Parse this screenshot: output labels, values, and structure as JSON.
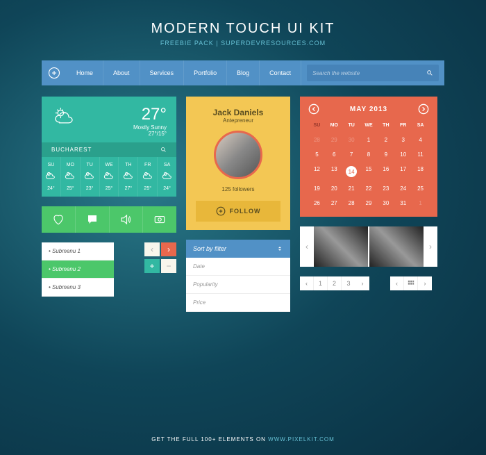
{
  "header": {
    "title": "MODERN TOUCH UI KIT",
    "subtitle_prefix": "FREEBIE PACK  |  ",
    "subtitle_link": "SUPERDEVRESOURCES.COM"
  },
  "nav": {
    "items": [
      "Home",
      "About",
      "Services",
      "Portfolio",
      "Blog",
      "Contact"
    ],
    "search_placeholder": "Search the website"
  },
  "weather": {
    "temp": "27°",
    "condition": "Mostly Sunny",
    "range": "27°/15°",
    "city": "BUCHAREST",
    "forecast": [
      {
        "d": "SU",
        "t": "24°"
      },
      {
        "d": "MO",
        "t": "25°"
      },
      {
        "d": "TU",
        "t": "23°"
      },
      {
        "d": "WE",
        "t": "25°"
      },
      {
        "d": "TH",
        "t": "27°"
      },
      {
        "d": "FR",
        "t": "25°"
      },
      {
        "d": "SA",
        "t": "24°"
      }
    ]
  },
  "submenu": [
    "Submenu 1",
    "Submenu 2",
    "Submenu 3"
  ],
  "profile": {
    "name": "Jack Daniels",
    "role": "Antepreneur",
    "followers": "125 followers",
    "follow": "FOLLOW"
  },
  "sort": {
    "header": "Sort by filter",
    "items": [
      "Date",
      "Popularity",
      "Price"
    ]
  },
  "calendar": {
    "month": "MAY 2013",
    "dow": [
      "SU",
      "MO",
      "TU",
      "WE",
      "TH",
      "FR",
      "SA"
    ],
    "days": [
      {
        "n": "28",
        "m": true
      },
      {
        "n": "29",
        "m": true
      },
      {
        "n": "30",
        "m": true
      },
      {
        "n": "1"
      },
      {
        "n": "2"
      },
      {
        "n": "3"
      },
      {
        "n": "4"
      },
      {
        "n": "5"
      },
      {
        "n": "6"
      },
      {
        "n": "7"
      },
      {
        "n": "8"
      },
      {
        "n": "9"
      },
      {
        "n": "10"
      },
      {
        "n": "11"
      },
      {
        "n": "12"
      },
      {
        "n": "13"
      },
      {
        "n": "14",
        "today": true
      },
      {
        "n": "15"
      },
      {
        "n": "16"
      },
      {
        "n": "17"
      },
      {
        "n": "18"
      },
      {
        "n": "19"
      },
      {
        "n": "20"
      },
      {
        "n": "21"
      },
      {
        "n": "22"
      },
      {
        "n": "23"
      },
      {
        "n": "24"
      },
      {
        "n": "25"
      },
      {
        "n": "26"
      },
      {
        "n": "27"
      },
      {
        "n": "28"
      },
      {
        "n": "29"
      },
      {
        "n": "30"
      },
      {
        "n": "31"
      },
      {
        "n": "1",
        "m": true
      }
    ]
  },
  "pagination": [
    "1",
    "2",
    "3"
  ],
  "footer": {
    "text": "GET THE FULL 100+ ELEMENTS ON ",
    "link": "WWW.PIXELKIT.COM"
  }
}
